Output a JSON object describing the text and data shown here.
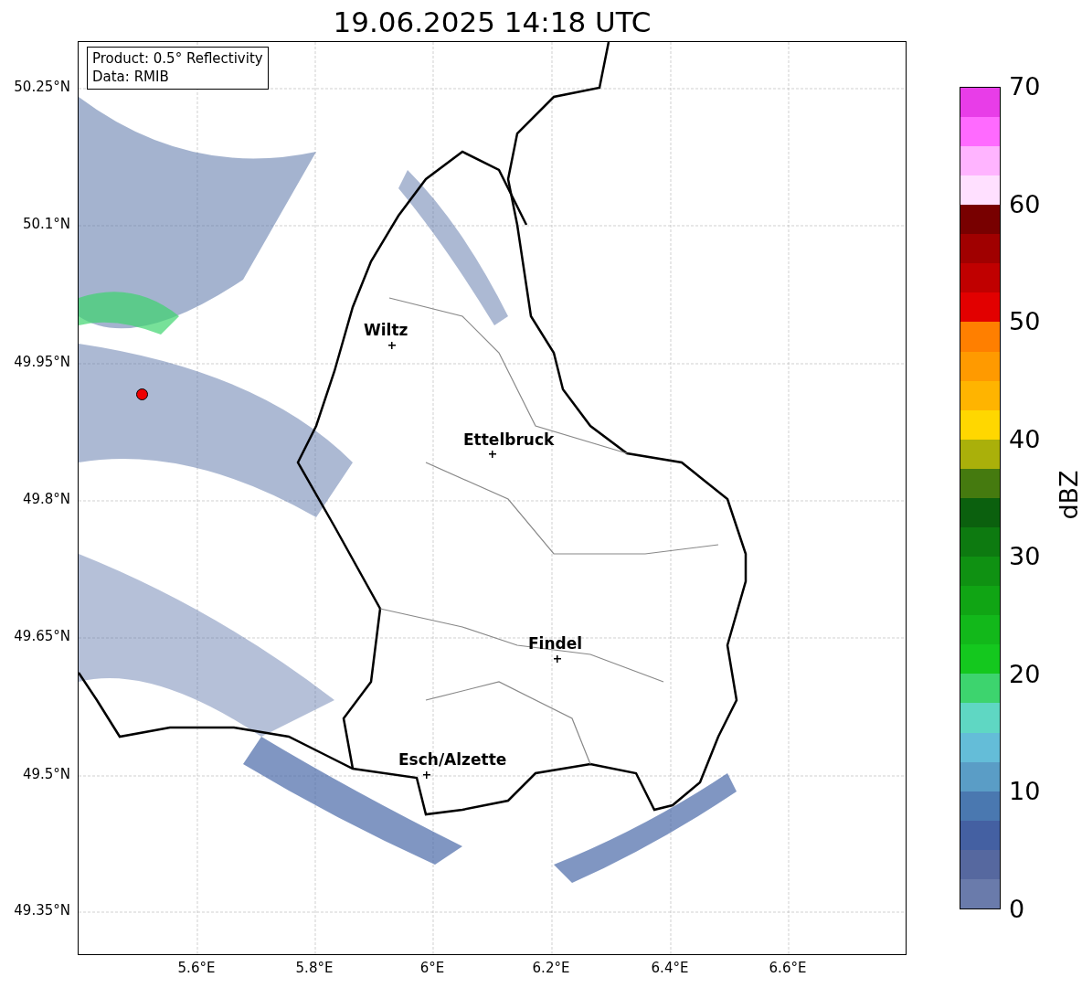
{
  "title": "19.06.2025 14:18 UTC",
  "info_box": [
    "Product: 0.5° Reflectivity",
    "Data: RMIB"
  ],
  "cities": [
    {
      "name": "Wiltz"
    },
    {
      "name": "Ettelbruck"
    },
    {
      "name": "Findel"
    },
    {
      "name": "Esch/Alzette"
    }
  ],
  "lat_ticks": [
    "50.25°N",
    "50.1°N",
    "49.95°N",
    "49.8°N",
    "49.65°N",
    "49.5°N",
    "49.35°N"
  ],
  "lon_ticks": [
    "5.6°E",
    "5.8°E",
    "6°E",
    "6.2°E",
    "6.4°E",
    "6.6°E"
  ],
  "colorbar": {
    "label": "dBZ",
    "ticks": [
      "70",
      "60",
      "50",
      "40",
      "30",
      "20",
      "10",
      "0"
    ],
    "bands": [
      {
        "color": "#6a7bab"
      },
      {
        "color": "#56689f"
      },
      {
        "color": "#4460a2"
      },
      {
        "color": "#4a78b0"
      },
      {
        "color": "#5a9dc6"
      },
      {
        "color": "#64bdd8"
      },
      {
        "color": "#5fd7c3"
      },
      {
        "color": "#3dd46e"
      },
      {
        "color": "#14c81e"
      },
      {
        "color": "#12b81a"
      },
      {
        "color": "#10a514"
      },
      {
        "color": "#0f9112"
      },
      {
        "color": "#0d7a10"
      },
      {
        "color": "#0b600e"
      },
      {
        "color": "#457a0f"
      },
      {
        "color": "#aab00a"
      },
      {
        "color": "#ffd700"
      },
      {
        "color": "#ffb400"
      },
      {
        "color": "#ff9a00"
      },
      {
        "color": "#ff7f00"
      },
      {
        "color": "#e20000"
      },
      {
        "color": "#c00000"
      },
      {
        "color": "#a00000"
      },
      {
        "color": "#780000"
      },
      {
        "color": "#ffe0ff"
      },
      {
        "color": "#ffb4ff"
      },
      {
        "color": "#ff6aff"
      },
      {
        "color": "#e83de8"
      }
    ]
  }
}
